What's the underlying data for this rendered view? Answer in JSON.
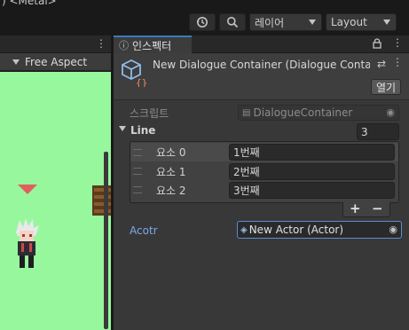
{
  "topbar": {
    "title_fragment": ") <Metal>",
    "history_icon": "history-icon",
    "search_icon": "search-icon",
    "layer_dropdown": "레이어",
    "layout_dropdown": "Layout"
  },
  "game_view": {
    "aspect_dropdown": "Free Aspect",
    "background_color": "#97f79c"
  },
  "inspector": {
    "tab_label": "인스펙터",
    "object_title": "New Dialogue Container (Dialogue Containe",
    "open_button": "열기",
    "script_label": "스크립트",
    "script_value": "DialogueContainer",
    "line_label": "Line",
    "line_count": "3",
    "elements": [
      {
        "label": "요소 0",
        "value": "1번째"
      },
      {
        "label": "요소 1",
        "value": "2번째"
      },
      {
        "label": "요소 2",
        "value": "3번째"
      }
    ],
    "add_button": "+",
    "remove_button": "−",
    "actor_label": "Acotr",
    "actor_value": "New Actor (Actor)",
    "accent_color": "#7aa9e8"
  }
}
